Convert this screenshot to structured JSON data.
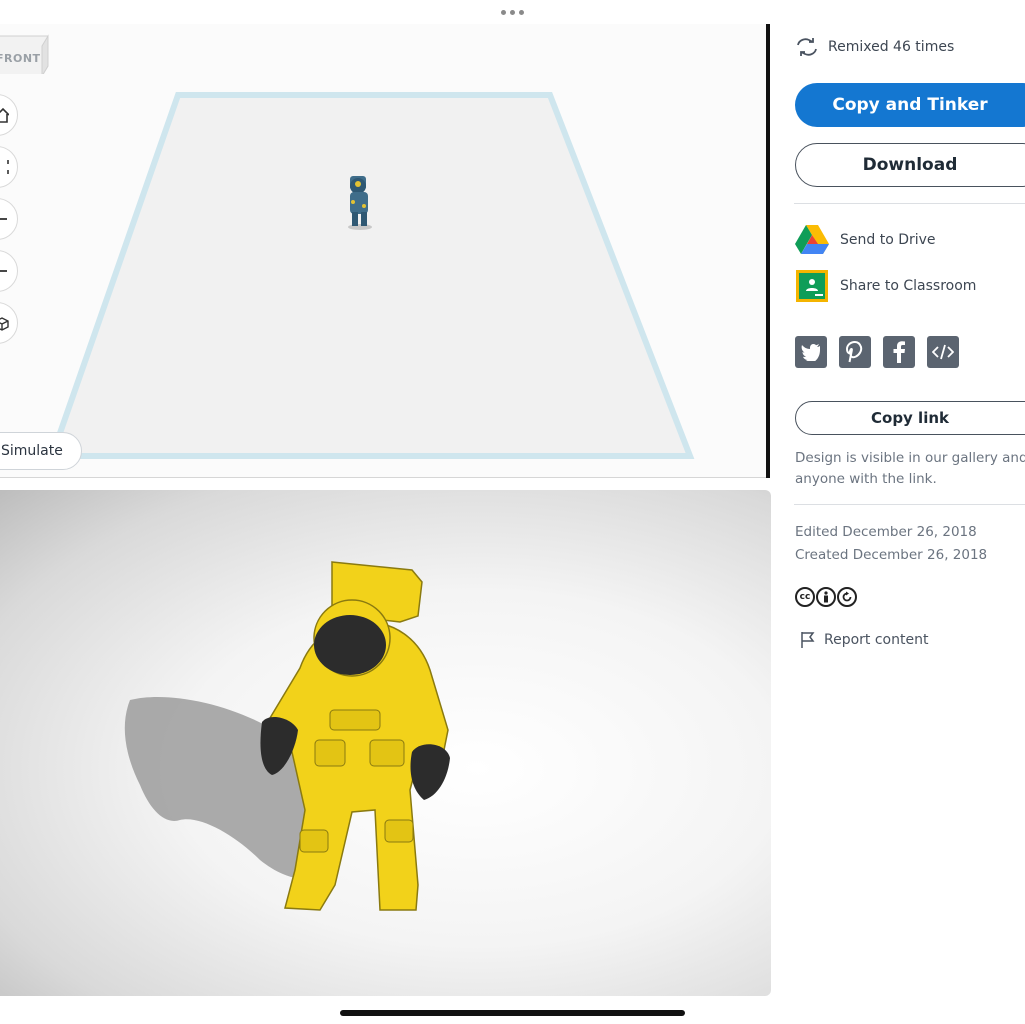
{
  "workplane": {
    "viewcube_label": "FRONT",
    "nav_buttons": [
      "home-view-icon",
      "fit-all-icon",
      "zoom-in-icon",
      "zoom-out-icon",
      "perspective-icon"
    ],
    "simulate_label": "Simulate"
  },
  "side": {
    "remixed_text": "Remixed 46 times",
    "copy_tinker_label": "Copy and Tinker",
    "download_label": "Download",
    "send_drive_label": "Send to Drive",
    "share_classroom_label": "Share to Classroom",
    "social_icons": [
      "twitter-icon",
      "pinterest-icon",
      "facebook-icon",
      "embed-icon"
    ],
    "copy_link_label": "Copy link",
    "visibility_note": "Design is visible in our gallery and anyone with the link.",
    "edited": "Edited December 26, 2018",
    "created": "Created December 26, 2018",
    "license_icons": [
      "cc-icon",
      "by-icon",
      "sa-icon"
    ],
    "report_label": "Report content"
  },
  "colors": {
    "accent": "#1477d1",
    "astronaut_yellow": "#f2d21a",
    "workplane_border": "#cfe6ee"
  }
}
